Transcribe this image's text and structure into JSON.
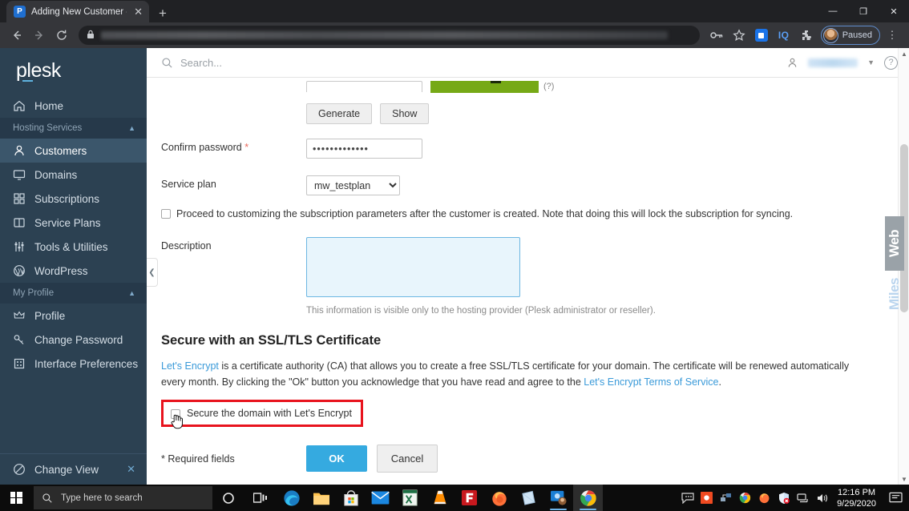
{
  "browser": {
    "tab": {
      "title": "Adding New Customer - Plesk O",
      "favicon_letter": "P",
      "close_icon": "close-icon"
    },
    "new_tab_label": "+",
    "window_controls": {
      "minimize": "—",
      "maximize": "❐",
      "close": "✕"
    },
    "toolbar": {
      "back_icon": "←",
      "forward_icon": "→",
      "reload_icon": "⟳",
      "lock_icon": "lock-icon",
      "url_value": "",
      "key_icon": "⚷",
      "bookmark_icon": "☆",
      "extension_iq_label": "IQ",
      "puzzle_icon": "❖",
      "profile_label": "Paused",
      "menu_icon": "⋮"
    }
  },
  "plesk": {
    "logo": "plesk",
    "search": {
      "placeholder": "Search...",
      "icon": "search-icon"
    },
    "help_icon": "?",
    "sidebar": {
      "home": {
        "label": "Home",
        "icon": "home-icon"
      },
      "group_hosting": {
        "label": "Hosting Services",
        "chevron": "⌃"
      },
      "group_profile": {
        "label": "My Profile",
        "chevron": "⌃"
      },
      "items": [
        {
          "label": "Customers",
          "icon": "user-icon",
          "active": true
        },
        {
          "label": "Domains",
          "icon": "monitor-icon",
          "active": false
        },
        {
          "label": "Subscriptions",
          "icon": "grid-icon",
          "active": false
        },
        {
          "label": "Service Plans",
          "icon": "book-icon",
          "active": false
        },
        {
          "label": "Tools & Utilities",
          "icon": "sliders-icon",
          "active": false
        },
        {
          "label": "WordPress",
          "icon": "wordpress-icon",
          "active": false
        }
      ],
      "profile_items": [
        {
          "label": "Profile",
          "icon": "crown-icon"
        },
        {
          "label": "Change Password",
          "icon": "key-icon"
        },
        {
          "label": "Interface Preferences",
          "icon": "panel-icon"
        }
      ],
      "change_view": {
        "label": "Change View",
        "icon": "circle-slash-icon",
        "close_icon": "✕"
      },
      "collapse_icon": "❮"
    },
    "watermark": {
      "top": "Web",
      "bottom": "Miles"
    },
    "form": {
      "password_meter_note": "(?)",
      "generate_label": "Generate",
      "show_label": "Show",
      "confirm_password": {
        "label": "Confirm password",
        "required_mark": "*",
        "value": "•••••••••••••"
      },
      "service_plan": {
        "label": "Service plan",
        "value": "mw_testplan",
        "options": [
          "mw_testplan"
        ]
      },
      "proceed_checkbox": {
        "label": "Proceed to customizing the subscription parameters after the customer is created. Note that doing this will lock the subscription for syncing.",
        "checked": false
      },
      "description": {
        "label": "Description",
        "value": "",
        "hint": "This information is visible only to the hosting provider (Plesk administrator or reseller)."
      }
    },
    "ssl_section": {
      "title": "Secure with an SSL/TLS Certificate",
      "link_lets_encrypt": "Let's Encrypt",
      "paragraph_part1": " is a certificate authority (CA) that allows you to create a free SSL/TLS certificate for your domain. The certificate will be renewed automatically every month. By clicking the \"Ok\" button you acknowledge that you have read and agree to the ",
      "link_terms": "Let's Encrypt Terms of Service",
      "paragraph_end": ".",
      "secure_checkbox": {
        "label": "Secure the domain with Let's Encrypt",
        "checked": false
      },
      "highlight_color": "#e8141e"
    },
    "footer": {
      "required_note": "* Required fields",
      "ok_label": "OK",
      "cancel_label": "Cancel",
      "ok_color": "#35aae0"
    }
  },
  "taskbar": {
    "start_icon": "windows-icon",
    "search_placeholder": "Type here to search",
    "cortana_icon": "○",
    "taskview_icon": "task-view-icon",
    "apps": [
      {
        "name": "edge-icon"
      },
      {
        "name": "file-explorer-icon"
      },
      {
        "name": "microsoft-store-icon"
      },
      {
        "name": "mail-icon"
      },
      {
        "name": "excel-icon"
      },
      {
        "name": "vlc-icon"
      },
      {
        "name": "filezilla-icon"
      },
      {
        "name": "firefox-icon"
      },
      {
        "name": "sticky-notes-icon"
      },
      {
        "name": "teamviewer-icon"
      },
      {
        "name": "chrome-active-icon"
      }
    ],
    "tray": [
      {
        "name": "chat-icon"
      },
      {
        "name": "record-icon"
      },
      {
        "name": "network-tool-icon"
      },
      {
        "name": "chrome-tray-icon"
      },
      {
        "name": "firefox-tray-icon"
      },
      {
        "name": "security-icon"
      },
      {
        "name": "network-icon"
      },
      {
        "name": "volume-icon"
      }
    ],
    "clock": {
      "time": "12:16 PM",
      "date": "9/29/2020"
    },
    "notification_icon": "notification-icon"
  }
}
